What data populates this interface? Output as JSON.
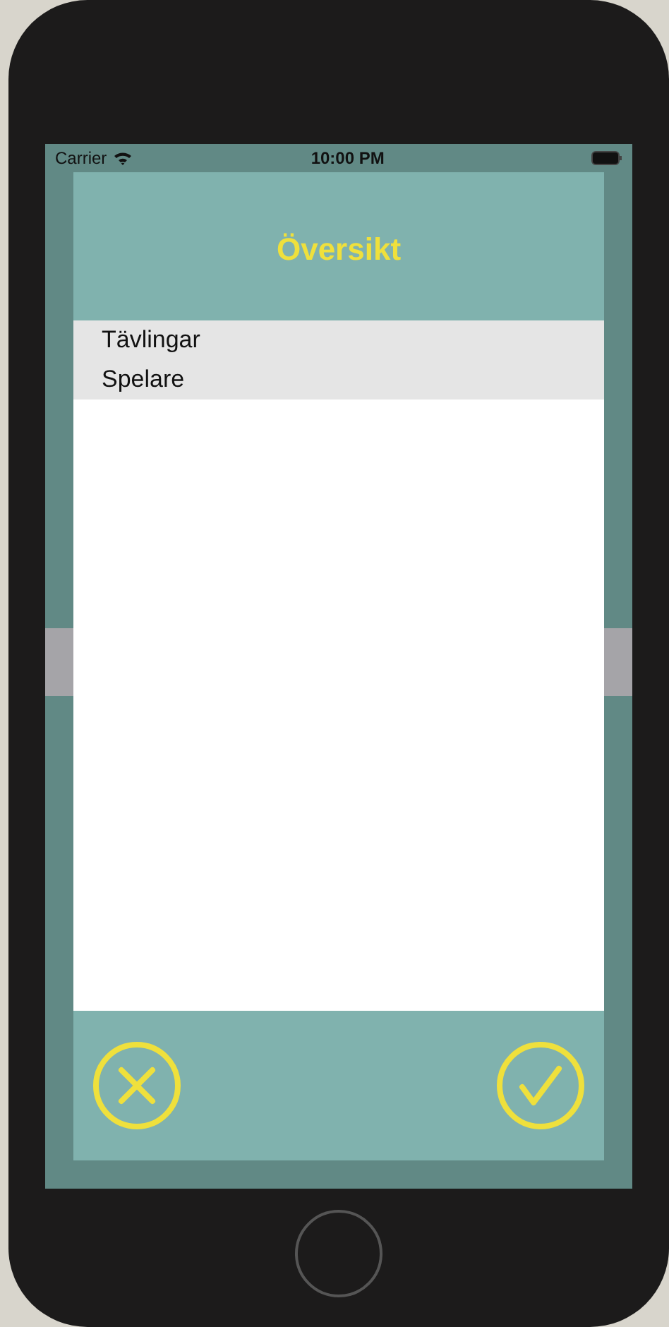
{
  "status_bar": {
    "carrier": "Carrier",
    "time": "10:00 PM"
  },
  "header": {
    "title": "Översikt"
  },
  "list": {
    "items": [
      {
        "label": "Tävlingar"
      },
      {
        "label": "Spelare"
      }
    ]
  },
  "footer": {
    "buttons": [
      {
        "kind": "cancel"
      },
      {
        "kind": "confirm"
      }
    ]
  }
}
